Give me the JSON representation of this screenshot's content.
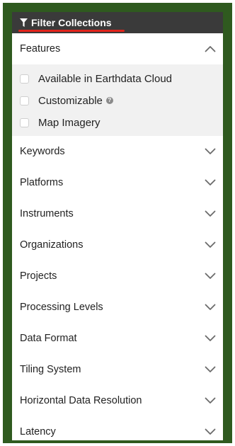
{
  "panel": {
    "title": "Filter Collections",
    "accent_color": "#e2231a",
    "header_color": "#3a3a3a",
    "border_color": "#2f5a1f"
  },
  "features": {
    "label": "Features",
    "expanded": true,
    "items": [
      {
        "label": "Available in Earthdata Cloud",
        "checked": false,
        "has_help": false
      },
      {
        "label": "Customizable",
        "checked": false,
        "has_help": true
      },
      {
        "label": "Map Imagery",
        "checked": false,
        "has_help": false
      }
    ]
  },
  "sections": [
    {
      "label": "Keywords"
    },
    {
      "label": "Platforms"
    },
    {
      "label": "Instruments"
    },
    {
      "label": "Organizations"
    },
    {
      "label": "Projects"
    },
    {
      "label": "Processing Levels"
    },
    {
      "label": "Data Format"
    },
    {
      "label": "Tiling System"
    },
    {
      "label": "Horizontal Data Resolution"
    },
    {
      "label": "Latency"
    }
  ],
  "help_icon_glyph": "?"
}
